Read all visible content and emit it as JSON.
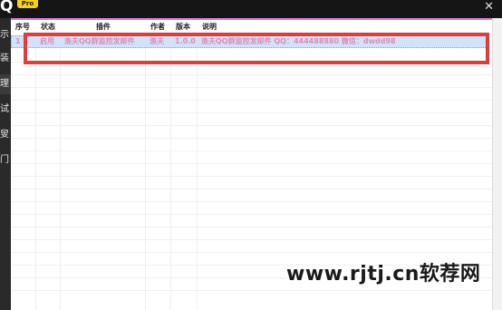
{
  "app": {
    "letter": "Q",
    "badge": "Pro",
    "close": "✕"
  },
  "sidebar": {
    "items": [
      {
        "label": "示"
      },
      {
        "label": "装"
      },
      {
        "label": "理"
      },
      {
        "label": "试"
      },
      {
        "label": "叟"
      },
      {
        "label": "门"
      }
    ]
  },
  "table": {
    "headers": [
      "序号",
      "状态",
      "插件",
      "作者",
      "版本",
      "说明"
    ],
    "rows": [
      {
        "num": "1",
        "status": "启用",
        "plugin": "渔夫QQ群监控发邮件",
        "author": "渔夫",
        "version": "1.0.0",
        "desc": "渔夫QQ群监控发邮件  QQ：444488880  微信：dwdd98"
      }
    ]
  },
  "watermark": "www.rjtj.cn软荐网"
}
